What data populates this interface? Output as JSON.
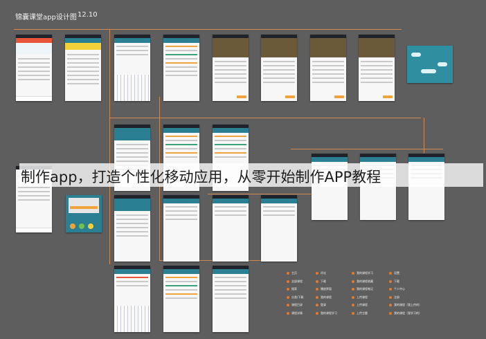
{
  "header": {
    "title": "锦囊课堂app设计图",
    "date": "12.10"
  },
  "overlay_caption": "制作app，打造个性化移动应用，从零开始制作APP教程",
  "colors": {
    "background": "#5e5e5e",
    "accent": "#e8782a",
    "connector": "#d08a52",
    "teal": "#2f8fa0",
    "gold": "#f0a33a"
  },
  "legend": {
    "col1": [
      "主页",
      "全部课程",
      "搜索",
      "分类/下载",
      "课程目录",
      "课程详情"
    ],
    "col2": [
      "评论",
      "下载",
      "播放界面",
      "我的课程",
      "登录",
      "我的课程学习"
    ],
    "col3": [
      "我的课程学习",
      "我的课程收藏",
      "我的课程笔记",
      "上传课程",
      "上传课程",
      "上传主题"
    ],
    "col4": [
      "设置",
      "下载",
      "个人中心",
      "注册",
      "我的课程（我上传的）",
      "我的课程（我学习的）"
    ]
  }
}
